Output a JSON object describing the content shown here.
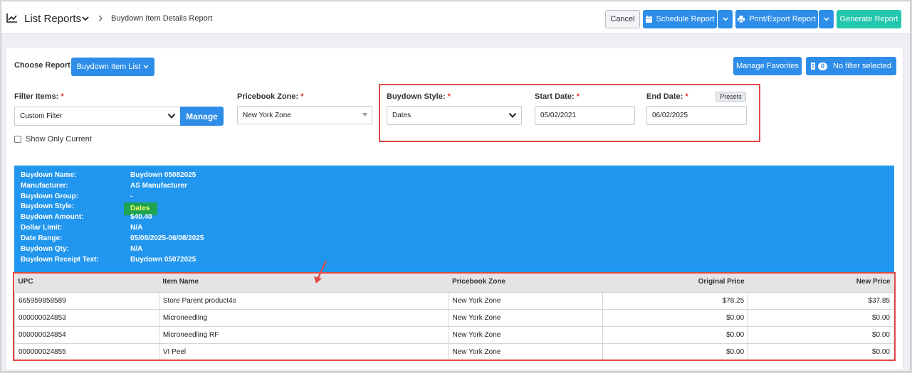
{
  "header": {
    "title": "List Reports",
    "breadcrumb": "Buydown Item Details Report",
    "buttons": {
      "cancel": "Cancel",
      "schedule": "Schedule Report",
      "print": "Print/Export Report",
      "generate": "Generate Report"
    }
  },
  "toolbar": {
    "choose_report_label": "Choose Report",
    "report_select": "Buydown Item List",
    "manage_favorites": "Manage Favorites",
    "filter_count": "0",
    "filter_status": "No filter selected"
  },
  "filters": {
    "filter_items": {
      "label": "Filter Items:",
      "required": "*",
      "value": "Custom Filter",
      "manage": "Manage"
    },
    "show_only_current": "Show Only Current",
    "pricebook_zone": {
      "label": "Pricebook Zone:",
      "required": "*",
      "value": "New York Zone"
    },
    "buydown_style": {
      "label": "Buydown Style:",
      "required": "*",
      "value": "Dates"
    },
    "start_date": {
      "label": "Start Date:",
      "required": "*",
      "value": "05/02/2021"
    },
    "end_date": {
      "label": "End Date:",
      "required": "*",
      "value": "06/02/2025",
      "presets": "Presets"
    }
  },
  "buydown_info": [
    {
      "key": "Buydown Name:",
      "value": "Buydown 05082025"
    },
    {
      "key": "Manufacturer:",
      "value": "AS Manufacturer"
    },
    {
      "key": "Buydown Group:",
      "value": "-"
    },
    {
      "key": "Buydown Style:",
      "value": "Dates"
    },
    {
      "key": "Buydown Amount:",
      "value": "$40.40"
    },
    {
      "key": "Dollar Limit:",
      "value": "N/A"
    },
    {
      "key": "Date Range:",
      "value": "05/08/2025-06/08/2025"
    },
    {
      "key": "Buydown Qty:",
      "value": "N/A"
    },
    {
      "key": "Buydown Receipt Text:",
      "value": "Buydown 05072025"
    }
  ],
  "table": {
    "columns": [
      "UPC",
      "Item Name",
      "Pricebook Zone",
      "Original Price",
      "New Price"
    ],
    "rows": [
      [
        "665959858589",
        "Store Parent product4s",
        "New York Zone",
        "$78.25",
        "$37.85"
      ],
      [
        "000000024853",
        "Microneedling",
        "New York Zone",
        "$0.00",
        "$0.00"
      ],
      [
        "000000024854",
        "Microneedling RF",
        "New York Zone",
        "$0.00",
        "$0.00"
      ],
      [
        "000000024855",
        "VI Peel",
        "New York Zone",
        "$0.00",
        "$0.00"
      ]
    ]
  },
  "colors": {
    "primary": "#2d8de8",
    "generate": "#22c7ad",
    "info_bg": "#2196ee",
    "highlight_bg": "#1ea351",
    "annotation_red": "#e04848"
  }
}
